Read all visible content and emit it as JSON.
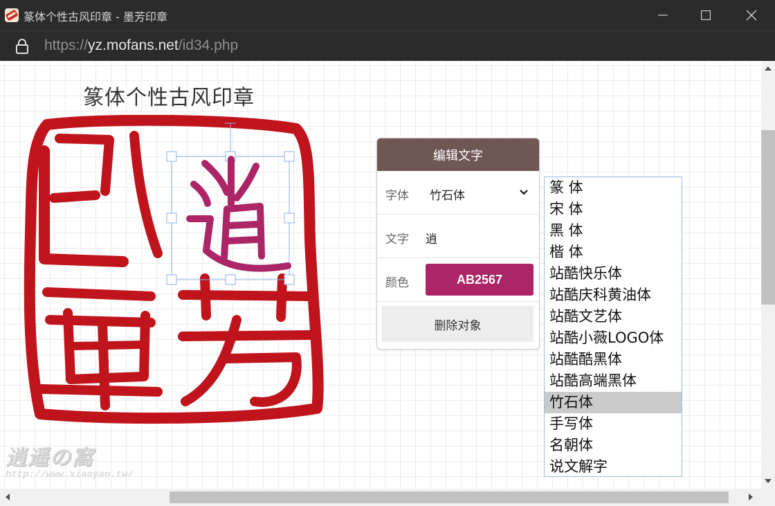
{
  "window": {
    "title": "篆体个性古风印章 - 墨芳印章",
    "minimize_icon": "minimize-icon",
    "maximize_icon": "maximize-icon",
    "close_icon": "close-icon"
  },
  "address": {
    "protocol": "https://",
    "domain": "yz.mofans.net",
    "path": "/id34.php",
    "lock_icon": "lock-icon"
  },
  "page": {
    "heading": "篆体个性古风印章"
  },
  "seal": {
    "color": "#C0141C",
    "selected_char_color": "#AB2567"
  },
  "editor": {
    "header": "编辑文字",
    "font_label": "字体",
    "font_value": "竹石体",
    "text_label": "文字",
    "text_value": "逍",
    "color_label": "颜色",
    "color_value": "AB2567",
    "delete_label": "删除对象"
  },
  "font_options": [
    "篆 体",
    "宋 体",
    "黑 体",
    "楷 体",
    "站酷快乐体",
    "站酷庆科黄油体",
    "站酷文艺体",
    "站酷小薇LOGO体",
    "站酷酷黑体",
    "站酷高端黑体",
    "竹石体",
    "手写体",
    "名朝体",
    "说文解字"
  ],
  "selected_font_index": 10,
  "watermark": {
    "name": "逍遥の窩",
    "url": "http://www.xiaoyao.tw/"
  }
}
